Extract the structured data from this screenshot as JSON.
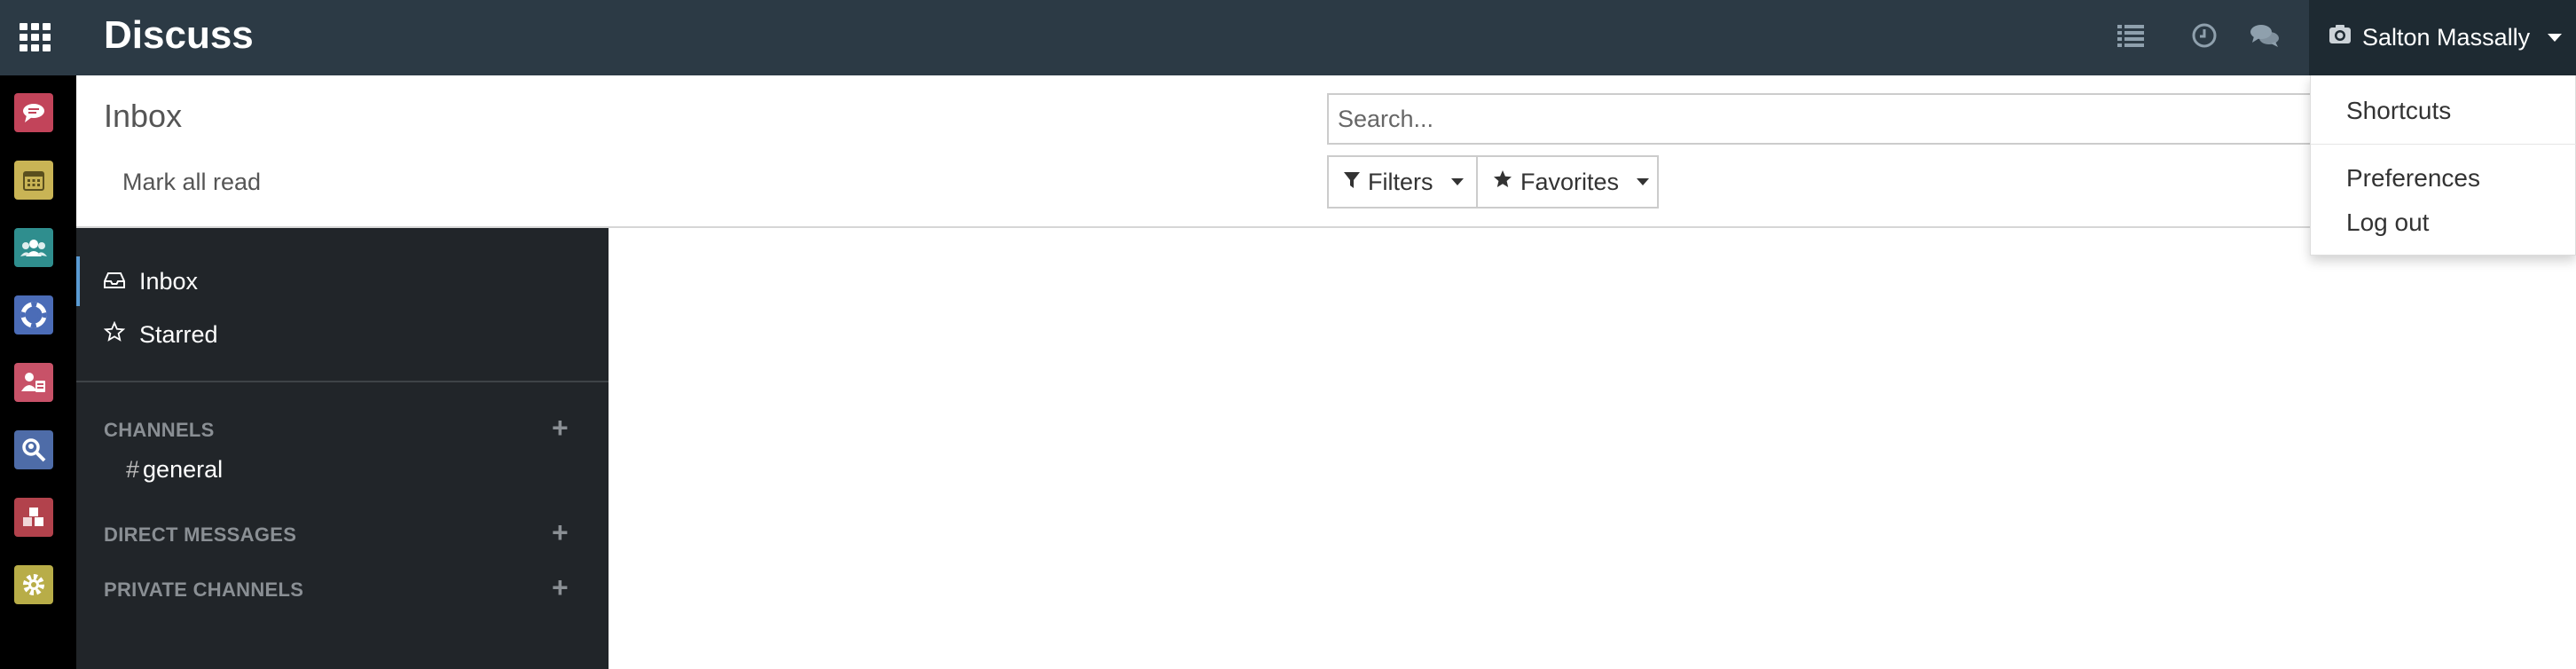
{
  "app": {
    "title": "Discuss"
  },
  "user": {
    "name": "Salton Massally"
  },
  "user_menu": {
    "items": [
      "Shortcuts",
      "Preferences",
      "Log out"
    ]
  },
  "control_panel": {
    "title": "Inbox",
    "mark_all_read": "Mark all read",
    "search_placeholder": "Search...",
    "filters_label": "Filters",
    "favorites_label": "Favorites"
  },
  "sidebar": {
    "mailboxes": [
      {
        "label": "Inbox",
        "icon": "inbox-icon",
        "active": true
      },
      {
        "label": "Starred",
        "icon": "star-icon",
        "active": false
      }
    ],
    "sections": [
      {
        "title": "CHANNELS",
        "channels": [
          "general"
        ]
      },
      {
        "title": "DIRECT MESSAGES",
        "channels": []
      },
      {
        "title": "PRIVATE CHANNELS",
        "channels": []
      }
    ],
    "channel_prefix": "#"
  },
  "app_icons": [
    {
      "name": "discuss-app-icon",
      "color": "#c2445a"
    },
    {
      "name": "calendar-app-icon",
      "color": "#c9b455"
    },
    {
      "name": "contacts-app-icon",
      "color": "#2f8e8e"
    },
    {
      "name": "helpdesk-app-icon",
      "color": "#4b6cb7"
    },
    {
      "name": "employees-app-icon",
      "color": "#c85268"
    },
    {
      "name": "search-app-icon",
      "color": "#4e6ca8"
    },
    {
      "name": "apps-app-icon",
      "color": "#b2424c"
    },
    {
      "name": "settings-app-icon",
      "color": "#b8ad48"
    }
  ],
  "colors": {
    "topbar": "#2c3a45",
    "sidebar": "#212529",
    "accent": "#5a9bd3"
  }
}
